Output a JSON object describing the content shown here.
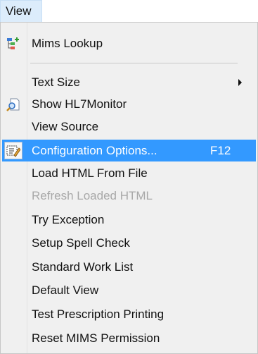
{
  "menubar": {
    "view_label": "View"
  },
  "menu": {
    "items": [
      {
        "label": "Mims Lookup",
        "icon": "tree-add-icon"
      },
      {
        "label": "Text Size",
        "submenu": true
      },
      {
        "label": "Show HL7Monitor",
        "icon": "document-search-icon"
      },
      {
        "label": "View Source"
      },
      {
        "label": "Configuration Options...",
        "shortcut": "F12",
        "icon": "config-edit-icon",
        "selected": true
      },
      {
        "label": "Load HTML From File"
      },
      {
        "label": "Refresh Loaded HTML",
        "disabled": true
      },
      {
        "label": "Try Exception"
      },
      {
        "label": "Setup Spell Check"
      },
      {
        "label": "Standard Work List"
      },
      {
        "label": "Default View"
      },
      {
        "label": "Test Prescription Printing"
      },
      {
        "label": "Reset MIMS Permission"
      }
    ]
  },
  "colors": {
    "highlight": "#3399ff",
    "menu_bg": "#f0f0f0",
    "disabled_text": "#a8a8a8"
  }
}
